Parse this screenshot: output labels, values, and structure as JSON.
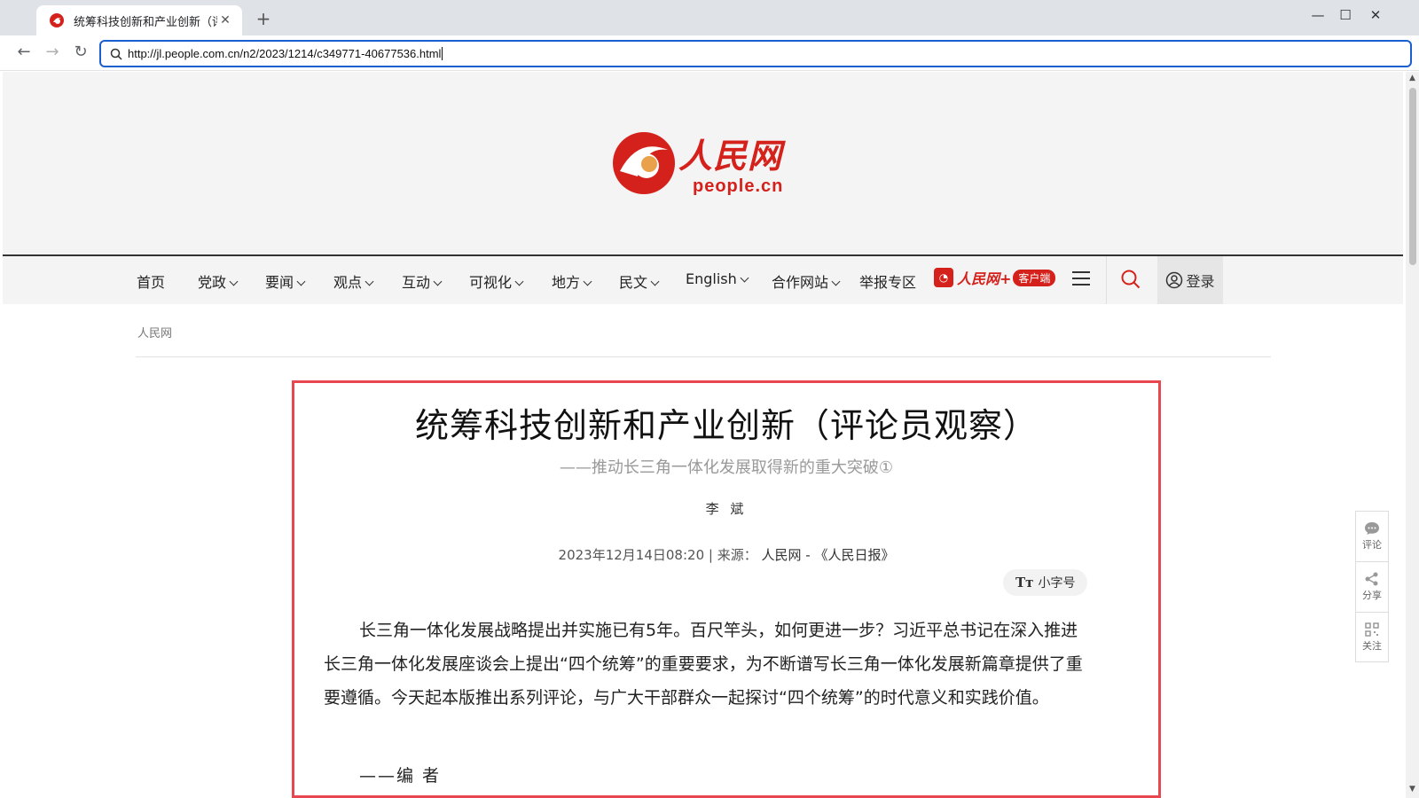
{
  "browser": {
    "tab_title": "统筹科技创新和产业创新（评...",
    "url": "http://jl.people.com.cn/n2/2023/1214/c349771-40677536.html"
  },
  "site": {
    "logo_name": "人民网",
    "logo_domain": "people.cn"
  },
  "nav": {
    "items": [
      "首页",
      "党政",
      "要闻",
      "观点",
      "互动",
      "可视化",
      "地方",
      "民文",
      "English",
      "合作网站",
      "举报专区"
    ],
    "app_name": "人民网+",
    "app_tag": "客户端",
    "login": "登录"
  },
  "breadcrumb": "人民网",
  "article": {
    "title": "统筹科技创新和产业创新（评论员观察）",
    "subtitle": "——推动长三角一体化发展取得新的重大突破①",
    "author": "李 斌",
    "date": "2023年12月14日08:20",
    "source_label": "| 来源：",
    "source": "人民网 - 《人民日报》",
    "font_toggle": "小字号",
    "body": "长三角一体化发展战略提出并实施已有5年。百尺竿头，如何更进一步？习近平总书记在深入推进长三角一体化发展座谈会上提出“四个统筹”的重要要求，为不断谱写长三角一体化发展新篇章提供了重要遵循。今天起本版推出系列评论，与广大干部群众一起探讨“四个统筹”的时代意义和实践价值。",
    "sign": "——编 者"
  },
  "side_tools": [
    "评论",
    "分享",
    "关注"
  ],
  "colors": {
    "brand": "#d5211b",
    "highlight": "#e8474f",
    "url_focus": "#1a5fd0"
  }
}
